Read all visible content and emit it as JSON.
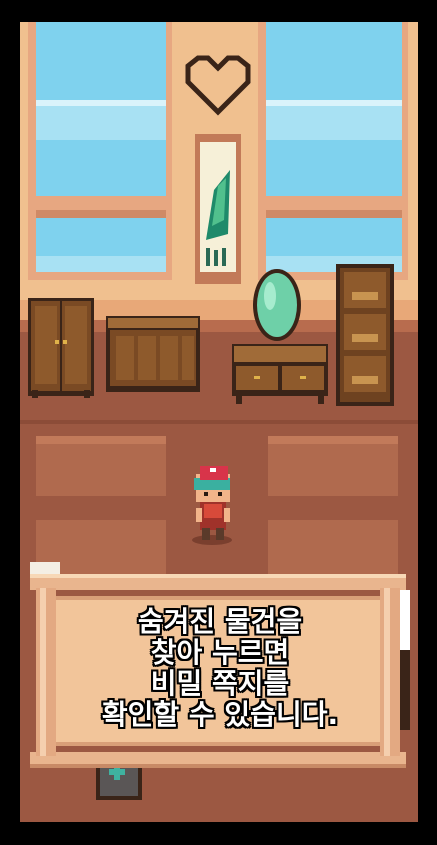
{
  "dialog": {
    "lines": [
      "숨겨진 물건을",
      "찾아 누르면",
      "비밀 쪽지를",
      "확인할 수 있습니다."
    ]
  },
  "colors": {
    "frame": "#000000",
    "wall": "#f0c08f",
    "floor": "#a05a43",
    "sky": "#7fd2ee",
    "scroll": "#f2c59a"
  },
  "icons": [
    "heart-outline-icon",
    "medical-cross-icon"
  ]
}
